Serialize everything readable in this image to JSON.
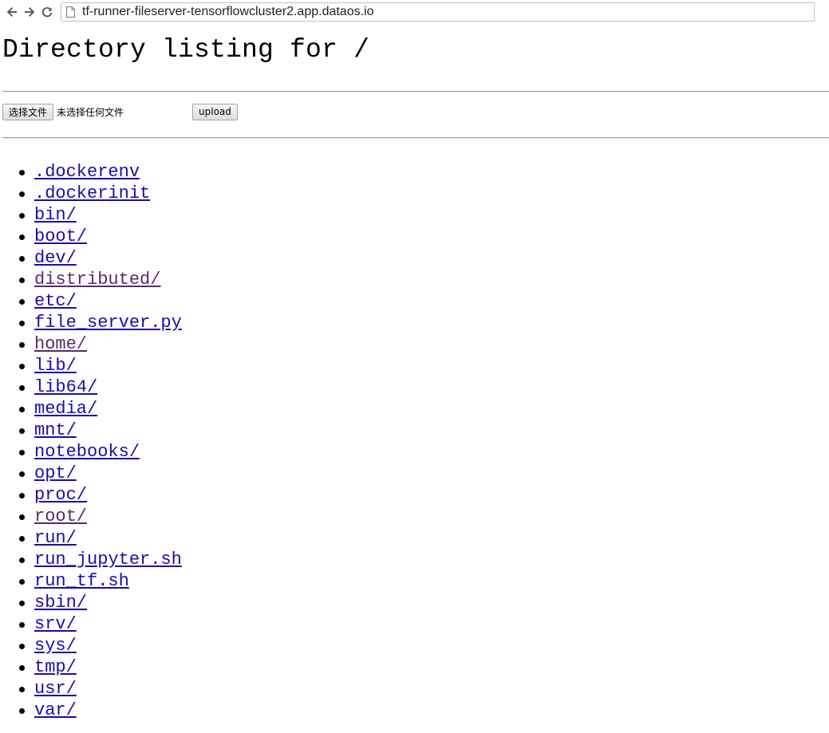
{
  "browser": {
    "url": "tf-runner-fileserver-tensorflowcluster2.app.dataos.io",
    "back_icon": "back-arrow-icon",
    "forward_icon": "forward-arrow-icon",
    "reload_icon": "reload-icon",
    "page_icon": "page-icon"
  },
  "page": {
    "title": "Directory listing for /"
  },
  "upload": {
    "choose_label": "选择文件",
    "no_file_text": "未选择任何文件",
    "upload_label": "upload"
  },
  "colors": {
    "link": "#1a0dab",
    "visited_link": "#5b2a6e"
  },
  "entries": [
    {
      "name": ".dockerenv",
      "visited": false
    },
    {
      "name": ".dockerinit",
      "visited": false
    },
    {
      "name": "bin/",
      "visited": false
    },
    {
      "name": "boot/",
      "visited": false
    },
    {
      "name": "dev/",
      "visited": false
    },
    {
      "name": "distributed/",
      "visited": true
    },
    {
      "name": "etc/",
      "visited": false
    },
    {
      "name": "file_server.py",
      "visited": false
    },
    {
      "name": "home/",
      "visited": true
    },
    {
      "name": "lib/",
      "visited": false
    },
    {
      "name": "lib64/",
      "visited": false
    },
    {
      "name": "media/",
      "visited": false
    },
    {
      "name": "mnt/",
      "visited": false
    },
    {
      "name": "notebooks/",
      "visited": false
    },
    {
      "name": "opt/",
      "visited": false
    },
    {
      "name": "proc/",
      "visited": false
    },
    {
      "name": "root/",
      "visited": true
    },
    {
      "name": "run/",
      "visited": false
    },
    {
      "name": "run_jupyter.sh",
      "visited": false
    },
    {
      "name": "run_tf.sh",
      "visited": false
    },
    {
      "name": "sbin/",
      "visited": false
    },
    {
      "name": "srv/",
      "visited": false
    },
    {
      "name": "sys/",
      "visited": false
    },
    {
      "name": "tmp/",
      "visited": false
    },
    {
      "name": "usr/",
      "visited": false
    },
    {
      "name": "var/",
      "visited": false
    }
  ]
}
